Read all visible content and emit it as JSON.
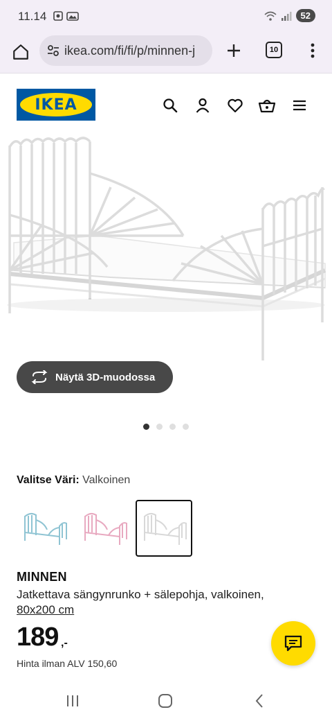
{
  "status_bar": {
    "time": "11.14",
    "battery": "52"
  },
  "browser": {
    "url": "ikea.com/fi/fi/p/minnen-j",
    "tab_count": "10"
  },
  "header": {
    "logo_text": "IKEA"
  },
  "product": {
    "view_3d_label": "Näytä 3D-muodossa",
    "color_label": "Valitse Väri:",
    "color_value": "Valkoinen",
    "name": "MINNEN",
    "description": "Jatkettava sängynrunko + sälepohja, valkoinen,",
    "size": "80x200 cm",
    "price": "189",
    "price_suffix": ",-",
    "vat_text": "Hinta ilman ALV 150,60"
  },
  "swatches": [
    {
      "color": "#8fc4d3",
      "selected": false
    },
    {
      "color": "#e8a9c0",
      "selected": false
    },
    {
      "color": "#e6e6e6",
      "selected": true
    }
  ],
  "colors": {
    "ikea_blue": "#0058a3",
    "ikea_yellow": "#ffdb00"
  },
  "icons": [
    "home-icon",
    "site-settings-icon",
    "plus-icon",
    "more-icon",
    "search-icon",
    "account-icon",
    "heart-icon",
    "basket-icon",
    "menu-icon",
    "rotate-3d-icon",
    "chat-icon"
  ]
}
